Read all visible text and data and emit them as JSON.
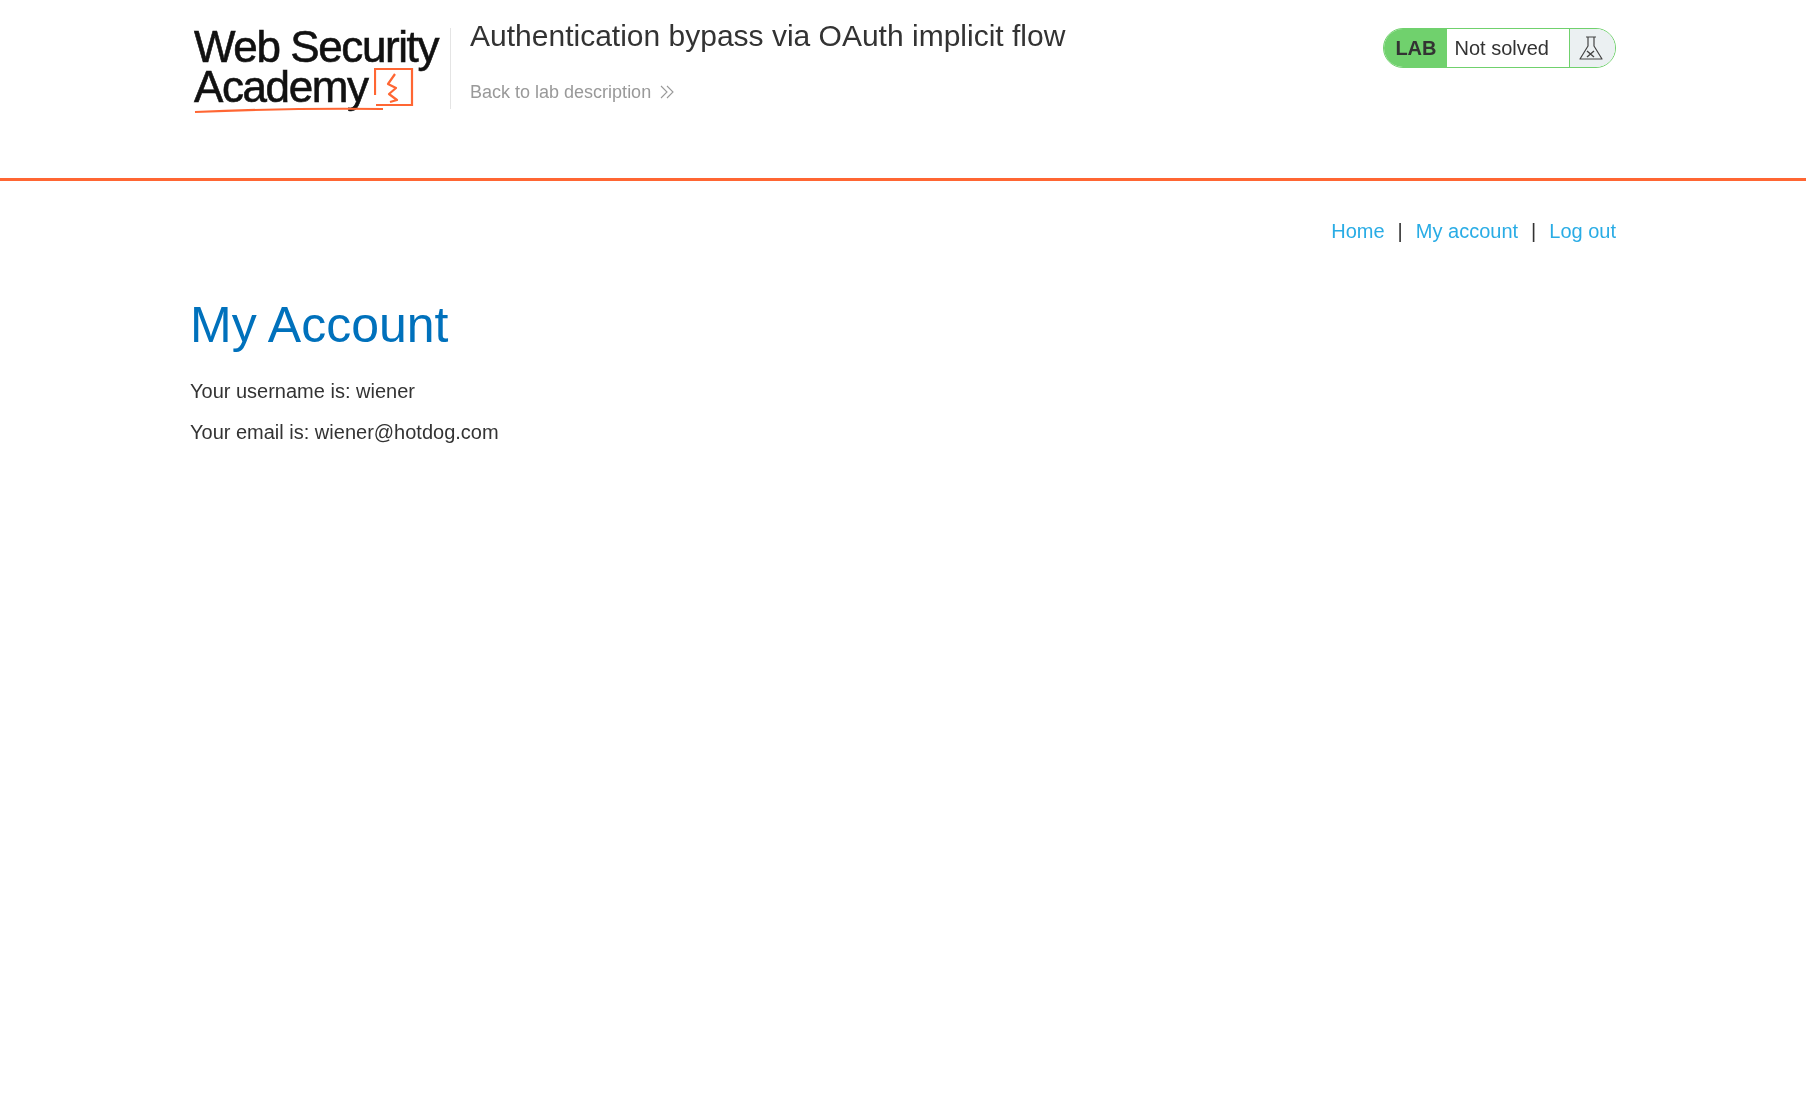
{
  "header": {
    "logo": {
      "line_1": "Web Security",
      "line_2": "Academy"
    },
    "lab_title": "Authentication bypass via OAuth implicit flow",
    "back_link": "Back to lab description",
    "lab_status": {
      "tag": "LAB",
      "status": "Not solved"
    }
  },
  "nav": {
    "items": [
      {
        "kind": "link",
        "label": "Home"
      },
      {
        "kind": "separator",
        "label": "|"
      },
      {
        "kind": "link",
        "label": "My account"
      },
      {
        "kind": "separator",
        "label": "|"
      },
      {
        "kind": "link",
        "label": "Log out"
      }
    ]
  },
  "page": {
    "heading": "My Account",
    "details": [
      "Your username is: wiener",
      "Your email is: wiener@hotdog.com"
    ]
  }
}
